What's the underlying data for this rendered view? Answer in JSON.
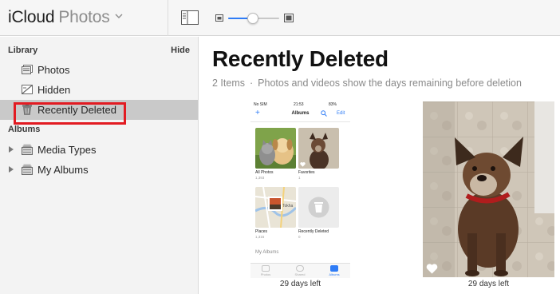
{
  "header": {
    "brand": "iCloud",
    "app_name": "Photos"
  },
  "sidebar": {
    "library_heading": "Library",
    "hide_label": "Hide",
    "library_items": [
      {
        "label": "Photos",
        "icon": "photos-icon"
      },
      {
        "label": "Hidden",
        "icon": "hidden-icon"
      },
      {
        "label": "Recently Deleted",
        "icon": "trash-icon",
        "selected": true
      }
    ],
    "albums_heading": "Albums",
    "album_groups": [
      {
        "label": "Media Types",
        "icon": "folder-stack-icon"
      },
      {
        "label": "My Albums",
        "icon": "folder-stack-icon"
      }
    ]
  },
  "main": {
    "title": "Recently Deleted",
    "item_count": "2 Items",
    "description": "Photos and videos show the days remaining before deletion",
    "items": [
      {
        "caption": "29 days left",
        "kind": "screenshot"
      },
      {
        "caption": "29 days left",
        "kind": "photo",
        "favorite": true
      }
    ]
  },
  "phone_screenshot": {
    "carrier": "No SIM",
    "time": "21:53",
    "battery": "83%",
    "nav_title": "Albums",
    "edit": "Edit",
    "albums": [
      {
        "name": "All Photos",
        "count": "1,393"
      },
      {
        "name": "Favorites",
        "count": "1"
      },
      {
        "name": "Places",
        "count": "1,315"
      },
      {
        "name": "Recently Deleted",
        "count": "0"
      }
    ],
    "map_label": "Tokha",
    "section": "My Albums",
    "tabs": [
      "Photos",
      "Shared",
      "Albums"
    ]
  },
  "colors": {
    "accent": "#2f7cf6",
    "highlight_border": "#e21b22",
    "selected_row": "#c9c9c9"
  },
  "zoom_slider_fraction": 0.48
}
